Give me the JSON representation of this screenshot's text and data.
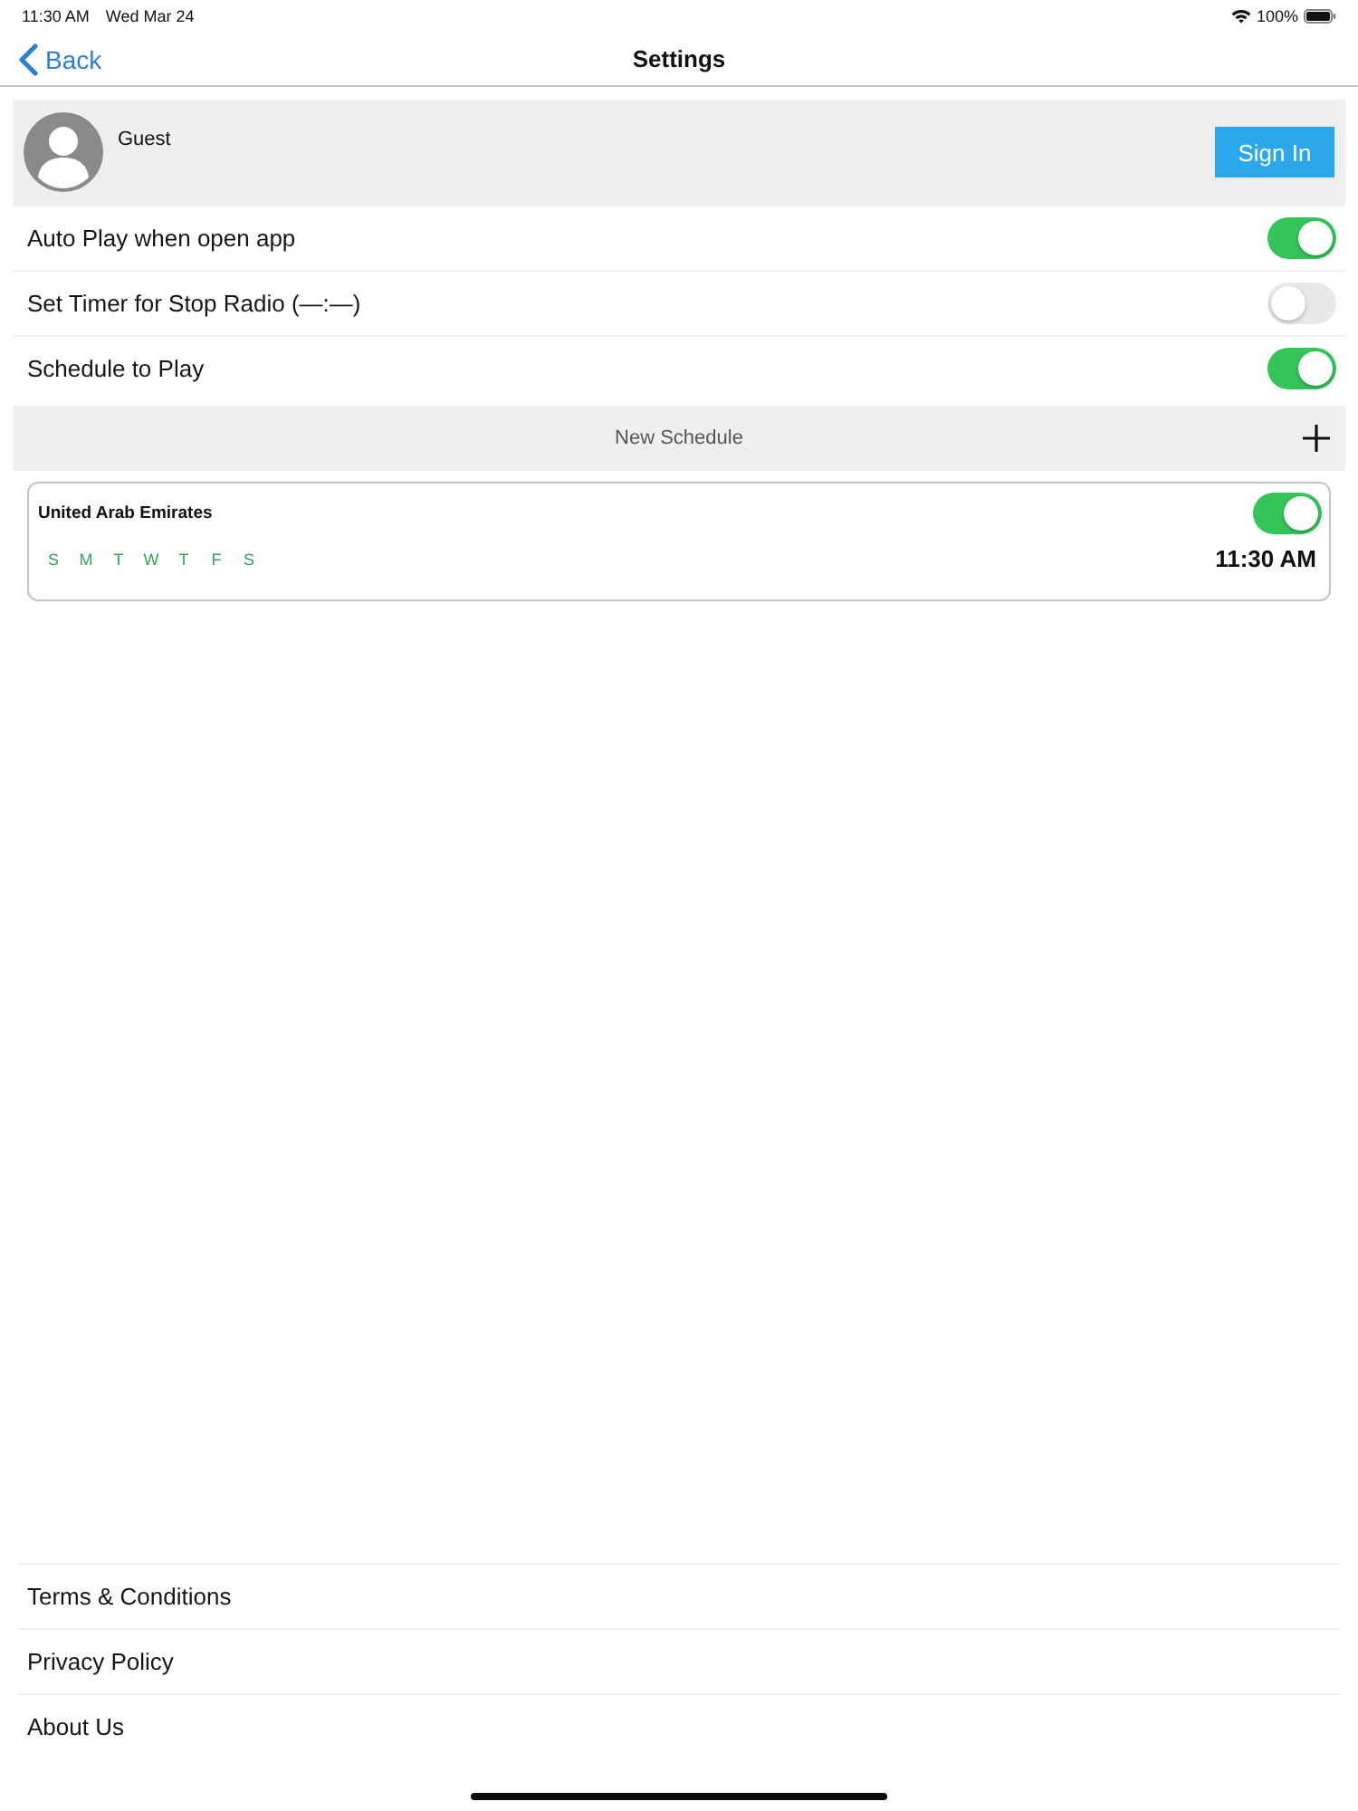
{
  "status_bar": {
    "time": "11:30 AM",
    "date": "Wed Mar 24",
    "battery": "100%"
  },
  "nav": {
    "back": "Back",
    "title": "Settings"
  },
  "profile": {
    "name": "Guest",
    "button": "Sign In"
  },
  "settings": [
    {
      "label": "Auto Play when open app",
      "on": true
    },
    {
      "label": "Set Timer for Stop Radio (—:—)",
      "on": false
    },
    {
      "label": "Schedule to Play",
      "on": true
    }
  ],
  "new_schedule": {
    "label": "New Schedule"
  },
  "schedules": [
    {
      "title": "United Arab Emirates",
      "on": true,
      "days": [
        {
          "label": "S",
          "selected": true
        },
        {
          "label": "M",
          "selected": true
        },
        {
          "label": "T",
          "selected": true
        },
        {
          "label": "W",
          "selected": true
        },
        {
          "label": "T",
          "selected": true
        },
        {
          "label": "F",
          "selected": true
        },
        {
          "label": "S",
          "selected": true
        }
      ],
      "time": "11:30 AM"
    }
  ],
  "links": [
    "Terms & Conditions",
    "Privacy Policy",
    "About Us"
  ]
}
